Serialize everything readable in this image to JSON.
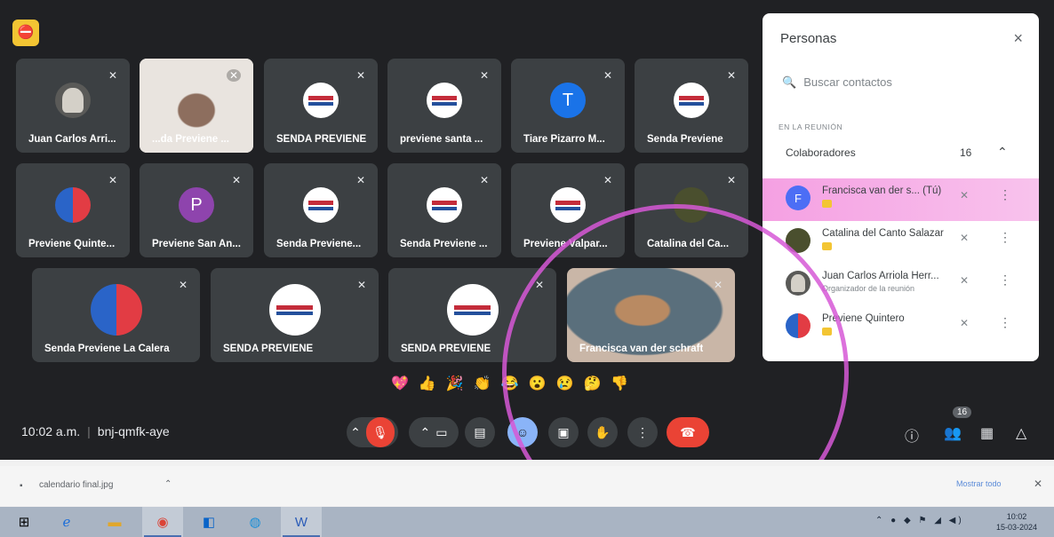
{
  "meeting": {
    "time": "10:02 a.m.",
    "code": "bnj-qmfk-aye",
    "people_count": "16",
    "tiles": [
      {
        "name": "Juan Carlos Arri..."
      },
      {
        "name": "...da Previene ..."
      },
      {
        "name": "SENDA PREVIENE"
      },
      {
        "name": "previene santa ..."
      },
      {
        "name": "Tiare Pizarro M...",
        "initial": "T"
      },
      {
        "name": "Senda Previene"
      },
      {
        "name": "Previene Quinte..."
      },
      {
        "name": "Previene San An...",
        "initial": "P"
      },
      {
        "name": "Senda Previene..."
      },
      {
        "name": "Senda Previene ..."
      },
      {
        "name": "Previene Valpar..."
      },
      {
        "name": "Catalina del Ca..."
      },
      {
        "name": "Senda Previene La Calera"
      },
      {
        "name": "SENDA PREVIENE"
      },
      {
        "name": "SENDA PREVIENE"
      },
      {
        "name": "Francisca van der schraft"
      }
    ],
    "reactions": [
      "💖",
      "👍",
      "🎉",
      "👏",
      "😂",
      "😮",
      "😢",
      "🤔",
      "👎"
    ]
  },
  "panel": {
    "title": "Personas",
    "close": "×",
    "search_placeholder": "Buscar contactos",
    "section": "EN LA REUNIÓN",
    "group": "Colaboradores",
    "group_count": "16",
    "people": [
      {
        "name": "Francisca van der s...  (Tú)",
        "initial": "F"
      },
      {
        "name": "Catalina del Canto Salazar"
      },
      {
        "name": "Juan Carlos Arriola Herr...",
        "sub": "Organizador de la reunión"
      },
      {
        "name": "Previene Quintero"
      }
    ]
  },
  "download": {
    "file": "calendario final.jpg",
    "show_all": "Mostrar todo"
  },
  "taskbar": {
    "clock_time": "10:02",
    "clock_date": "15-03-2024"
  },
  "colors": {
    "accent_red": "#ea4335",
    "accent_blue": "#8ab4f8",
    "highlight": "#ec52cb"
  }
}
